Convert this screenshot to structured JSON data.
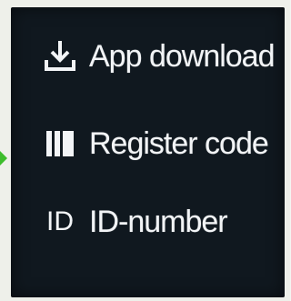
{
  "menu": {
    "items": [
      {
        "icon": "download-icon",
        "label": "App download"
      },
      {
        "icon": "barcode-icon",
        "label": "Register code"
      },
      {
        "icon": "id-icon",
        "icon_text": "ID",
        "label": "ID-number"
      }
    ]
  },
  "colors": {
    "screen_background": "#10181f",
    "text": "#f2f4f6",
    "side_arrow": "#3dbd2c"
  }
}
